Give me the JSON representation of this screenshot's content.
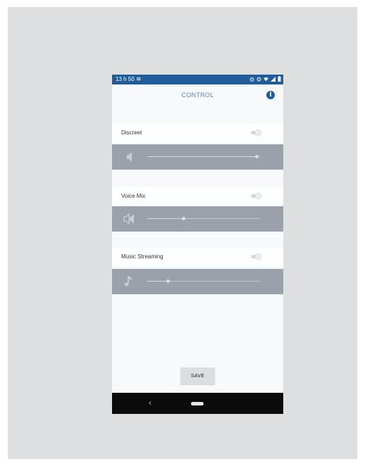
{
  "status_bar": {
    "time": "13 h 50",
    "notification_icon": "notification-icon",
    "icons": [
      "alarm-icon",
      "sync-icon",
      "wifi-icon",
      "signal-icon",
      "battery-icon"
    ]
  },
  "app_bar": {
    "title": "CONTROL",
    "info_icon_glyph": "i"
  },
  "settings": [
    {
      "label": "Discreet",
      "toggle_on": false,
      "slider_icon": "volume-low-icon",
      "slider_level": 0.97
    },
    {
      "label": "Voice Mix",
      "toggle_on": false,
      "slider_icon": "voice-mix-icon",
      "slider_level": 0.32
    },
    {
      "label": "Music Streaming",
      "toggle_on": false,
      "slider_icon": "music-note-icon",
      "slider_level": 0.18
    }
  ],
  "save_label": "SAVE",
  "nav_bar": {
    "back_glyph": "‹"
  },
  "colors": {
    "status_bar": "#1f5c99",
    "accent": "#5a86b8",
    "slider_band": "#9aa1aa",
    "background": "#f7f9fa",
    "nav_bar": "#0b0b0b"
  }
}
